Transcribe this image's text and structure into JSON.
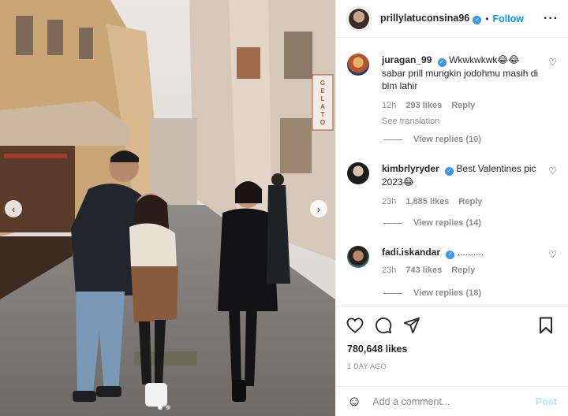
{
  "post": {
    "username": "prillylatuconsina96",
    "separator": "•",
    "follow_label": "Follow",
    "more_icon": "more-options-icon",
    "likes": "780,648 likes",
    "date": "1 DAY AGO"
  },
  "photo": {
    "shop_sign": "GELATO",
    "nav_prev_glyph": "‹",
    "nav_next_glyph": "›"
  },
  "comments": [
    {
      "username": "juragan_99",
      "verified": true,
      "text": "Wkwkwkwk😂😂 sabar prill mungkin jodohmu masih di blm lahir",
      "time": "12h",
      "likes": "293 likes",
      "reply_label": "Reply",
      "see_translation": "See translation",
      "view_replies": "View replies (10)"
    },
    {
      "username": "kimbrlyryder",
      "verified": true,
      "text": "Best Valentines pic 2023😂",
      "time": "23h",
      "likes": "1,885 likes",
      "reply_label": "Reply",
      "view_replies": "View replies (14)"
    },
    {
      "username": "fadi.iskandar",
      "verified": true,
      "text": "..........",
      "time": "23h",
      "likes": "743 likes",
      "reply_label": "Reply",
      "view_replies": "View replies (18)"
    }
  ],
  "comment_box": {
    "placeholder": "Add a comment...",
    "post_label": "Post"
  },
  "colors": {
    "accent": "#0095f6",
    "verified": "#3897f0",
    "muted": "#8e8e8e",
    "text": "#262626"
  }
}
